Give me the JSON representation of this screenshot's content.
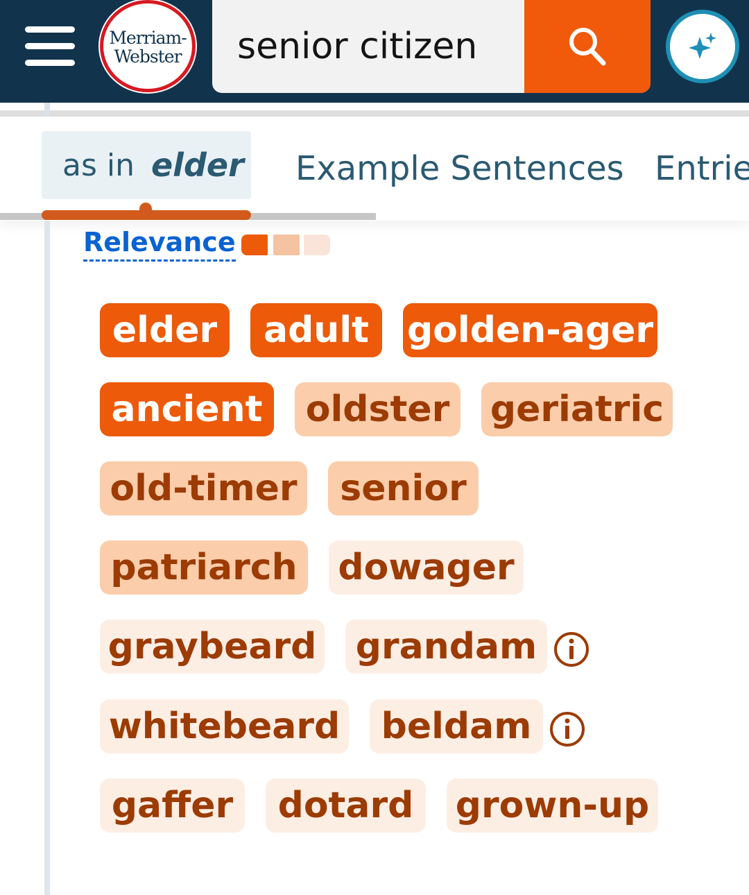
{
  "header": {
    "logo_text_line1": "Merriam-",
    "logo_text_line2": "Webster",
    "search_value": "senior citizen",
    "colors": {
      "navy": "#12334c",
      "accent": "#f05a0a",
      "logo_red": "#d71920",
      "ai_ring": "#1e8fb5"
    },
    "icons": {
      "menu": "hamburger-menu-icon",
      "search": "magnifier-icon",
      "ai": "sparkles-icon"
    }
  },
  "tabs": {
    "active_prefix": "as in",
    "active_word": "elder",
    "items": [
      "Example Sentences",
      "Entrie"
    ]
  },
  "relevance": {
    "label": "Relevance",
    "levels": [
      "high",
      "medium",
      "low"
    ],
    "colors": [
      "#ec5a0a",
      "#f4c3a2",
      "#fae4d9"
    ]
  },
  "synonyms": [
    {
      "word": "elder",
      "relevance": "high"
    },
    {
      "word": "adult",
      "relevance": "high"
    },
    {
      "word": "golden-ager",
      "relevance": "high"
    },
    {
      "word": "ancient",
      "relevance": "high"
    },
    {
      "word": "oldster",
      "relevance": "medium"
    },
    {
      "word": "geriatric",
      "relevance": "medium"
    },
    {
      "word": "old-timer",
      "relevance": "medium"
    },
    {
      "word": "senior",
      "relevance": "medium"
    },
    {
      "word": "patriarch",
      "relevance": "medium"
    },
    {
      "word": "dowager",
      "relevance": "low"
    },
    {
      "word": "graybeard",
      "relevance": "low"
    },
    {
      "word": "grandam",
      "relevance": "low",
      "info": true
    },
    {
      "word": "whitebeard",
      "relevance": "low"
    },
    {
      "word": "beldam",
      "relevance": "low",
      "info": true
    },
    {
      "word": "gaffer",
      "relevance": "low"
    },
    {
      "word": "dotard",
      "relevance": "low"
    },
    {
      "word": "grown-up",
      "relevance": "low"
    }
  ]
}
